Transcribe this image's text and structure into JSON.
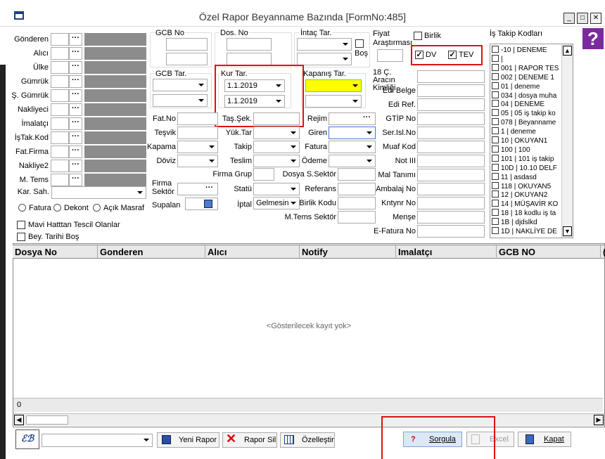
{
  "window": {
    "title": "Özel Rapor Beyanname Bazında [FormNo:485]",
    "min": "_",
    "max": "□",
    "close": "✕"
  },
  "left_fields": [
    {
      "label": "Gönderen"
    },
    {
      "label": "Alıcı"
    },
    {
      "label": "Ülke"
    },
    {
      "label": "Gümrük"
    },
    {
      "label": "Ş. Gümrük"
    },
    {
      "label": "Nakliyeci"
    },
    {
      "label": "İmalatçı"
    },
    {
      "label": "İşTak.Kod"
    },
    {
      "label": "Fat.Firma"
    },
    {
      "label": "Nakliye2"
    },
    {
      "label": "M. Tems"
    }
  ],
  "dots": "···",
  "kar_sah": {
    "label": "Kar. Sah."
  },
  "radios": {
    "fatura": "Fatura",
    "dekont": "Dekont",
    "acik_masraf": "Açık Masraf"
  },
  "checks_left": {
    "mavi": "Mavi Hatttan Tescil Olanlar",
    "bey_tarihi": "Bey. Tarihi Boş"
  },
  "gcb_no": "GCB No",
  "dos_no": "Dos. No",
  "intac_tar": "İntaç Tar.",
  "bos": "Boş",
  "gcb_tar": "GCB Tar.",
  "kur_tar": {
    "label": "Kur Tar.",
    "from": "1.1.2019",
    "to": "1.1.2019"
  },
  "kapanis_tar": "Kapanış Tar.",
  "fiyat": "Fiyat Araştırması",
  "birlik": "Birlik",
  "dv": "DV",
  "tev": "TEV",
  "mid_left": {
    "fat_no": "Fat.No",
    "tesvik": "Teşvik",
    "kapama": "Kapama",
    "doviz": "Döviz",
    "firma_sektor": "Firma Sektör",
    "supalan": "Supalan"
  },
  "mid": {
    "tas_sek": "Taş.Şek.",
    "yuk_tar": "Yük.Tar",
    "takip": "Takip",
    "teslim": "Teslim",
    "firma_grup": "Firma Grup",
    "dosya_s_sektor": "Dosya S.Sektör",
    "statu": "Statü",
    "referans": "Referans",
    "iptal": "İptal",
    "iptal_value": "Gelmesin",
    "birlik_kodu": "Birlik Kodu",
    "m_tems_sektor": "M.Tems Sektör"
  },
  "mid_right": {
    "rejim": "Rejim",
    "giren": "Giren",
    "fatura": "Fatura",
    "odeme": "Ödeme"
  },
  "right_col": {
    "arac": "18 Ç. Aracın Kimliği",
    "edi_belge": "Edi Belge",
    "edi_ref": "Edi Ref.",
    "gtip": "GTİP No",
    "ser_isl": "Ser.Isl.No",
    "muaf": "Muaf Kod",
    "not3": "Not III",
    "mal_tanimi": "Mal Tanımı",
    "ambalaj": "Ambalaj No",
    "kntynr": "Kntynr No",
    "mense": "Menşe",
    "e_fatura": "E-Fatura No"
  },
  "is_takip": {
    "label": "İş Takip Kodları",
    "items": [
      "-10 | DENEME",
      "|",
      "001 | RAPOR TES",
      "002 | DENEME 1",
      "01 | deneme",
      "034 | dosya muha",
      "04 | DENEME",
      "05 | 05 iş takip ko",
      "078 | Beyanname",
      "1 | deneme",
      "10 | OKUYAN1",
      "100 | 100",
      "101 | 101 iş takip",
      "10D | 10.10 DELF",
      "11 | asdasd",
      "118 | OKUYAN5",
      "12 | OKUYAN2",
      "14 | MÜŞAVİR KO",
      "18 | 18 kodlu iş ta",
      "1B | djdslkd",
      "1D | NAKLİYE DE"
    ]
  },
  "grid": {
    "columns": [
      "Dosya No",
      "Gonderen",
      "Alıcı",
      "Notify",
      "Imalatçı",
      "GCB NO",
      "("
    ],
    "empty": "<Gösterilecek kayıt yok>",
    "footer_count": "0"
  },
  "toolbar": {
    "yeni_rapor": "Yeni Rapor",
    "rapor_sil": "Rapor Sil",
    "ozellestir": "Özelleştir",
    "sorgula": "Sorgula",
    "excel": "Excel",
    "kapat": "Kapat"
  },
  "help": "?"
}
